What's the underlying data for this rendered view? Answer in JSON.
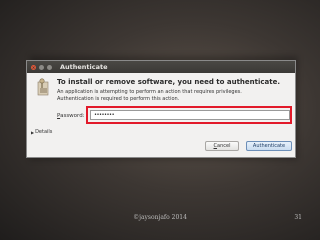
{
  "window": {
    "title": "Authenticate",
    "close_glyph": "×"
  },
  "dialog": {
    "heading": "To install or remove software, you need to authenticate.",
    "description_line1": "An application is attempting to perform an action that requires privileges.",
    "description_line2": "Authentication is required to perform this action.",
    "password_label_prefix": "",
    "password_label_mnemonic": "P",
    "password_label_rest": "assword:",
    "password_value": "••••••••",
    "details_label": "Details",
    "details_icon": "triangle-right-icon",
    "cancel_label_mnemonic": "C",
    "cancel_label_rest": "ancel",
    "authenticate_label": "Authenticate",
    "icon": "lock-key-icon"
  },
  "slide": {
    "credit": "©jaysonjafo 2014",
    "page_number": "31"
  },
  "colors": {
    "highlight": "#e21a2a",
    "titlebar": "#3b3936",
    "close_button": "#e0583a"
  }
}
